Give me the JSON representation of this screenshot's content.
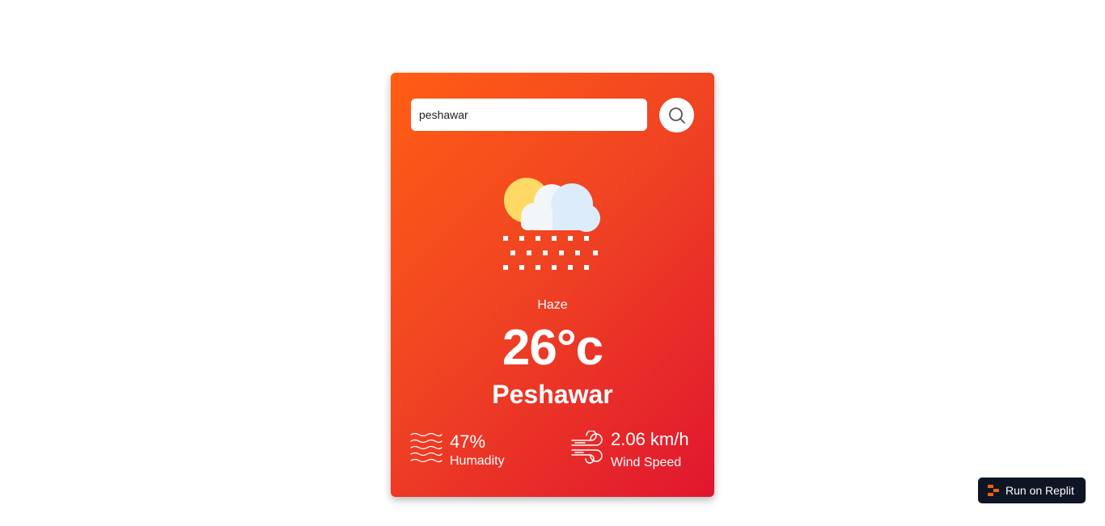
{
  "search": {
    "value": "peshawar",
    "icon": "search-icon"
  },
  "weather": {
    "icon": "cloud-sun-snow-icon",
    "condition": "Haze",
    "temperature": "26°c",
    "city": "Peshawar"
  },
  "details": {
    "humidity": {
      "icon": "humidity-waves-icon",
      "value": "47%",
      "label": "Humadity"
    },
    "wind": {
      "icon": "wind-icon",
      "value": "2.06 km/h",
      "label": "Wind Speed"
    }
  },
  "badge": {
    "label": "Run on Replit",
    "icon": "replit-logo-icon"
  },
  "colors": {
    "card_gradient_start": "#ff5e14",
    "card_gradient_end": "#e0162f",
    "badge_background": "#0e1525",
    "replit_orange": "#f26207"
  }
}
